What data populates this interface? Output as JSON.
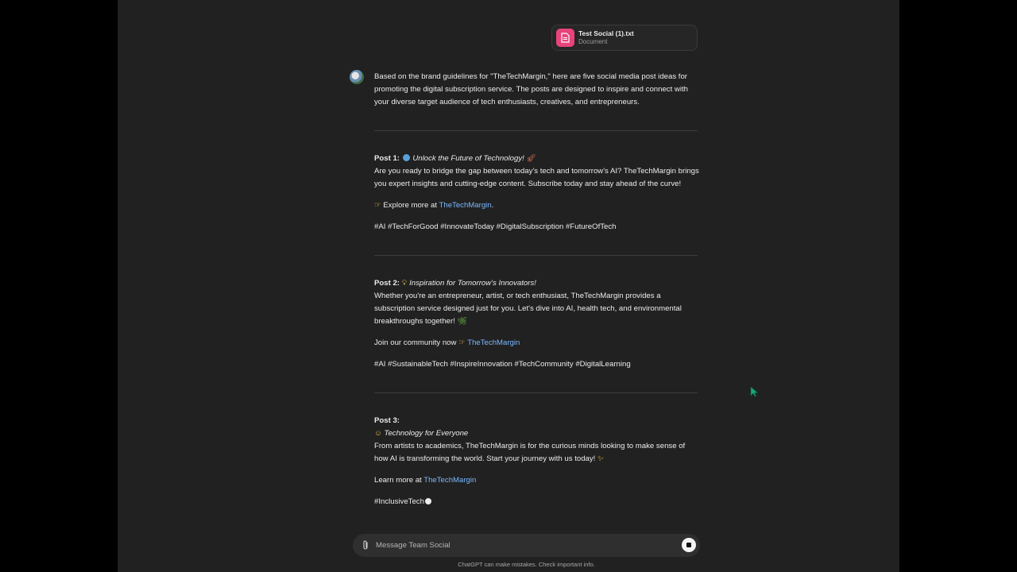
{
  "attachment": {
    "filename": "Test Social (1).txt",
    "type": "Document",
    "icon": "document-icon",
    "icon_color": "#e8437a"
  },
  "message": {
    "intro": "Based on the brand guidelines for \"TheTechMargin,\" here are five social media post ideas for promoting the digital subscription service. The posts are designed to inspire and connect with your diverse target audience of tech enthusiasts, creatives, and entrepreneurs.",
    "posts": [
      {
        "label": "Post 1:",
        "title": "Unlock the Future of Technology!",
        "body": "Are you ready to bridge the gap between today's tech and tomorrow's AI? TheTechMargin brings you expert insights and cutting-edge content. Subscribe today and stay ahead of the curve!",
        "cta_text": "Explore more at",
        "cta_link": "TheTechMargin",
        "cta_suffix": ".",
        "hashtags": "#AI #TechForGood #InnovateToday #DigitalSubscription #FutureOfTech"
      },
      {
        "label": "Post 2:",
        "title": "Inspiration for Tomorrow's Innovators!",
        "body": "Whether you're an entrepreneur, artist, or tech enthusiast, TheTechMargin provides a subscription service designed just for you. Let's dive into AI, health tech, and environmental breakthroughs together!",
        "cta_text": "Join our community now",
        "cta_link": "TheTechMargin",
        "hashtags": "#AI #SustainableTech #InspireInnovation #TechCommunity #DigitalLearning"
      },
      {
        "label": "Post 3:",
        "title": "Technology for Everyone",
        "body": "From artists to academics, TheTechMargin is for the curious minds looking to make sense of how AI is transforming the world. Start your journey with us today!",
        "cta_text": "Learn more at",
        "cta_link": "TheTechMargin",
        "hashtags": "#InclusiveTech"
      }
    ]
  },
  "composer": {
    "placeholder": "Message Team Social",
    "disclaimer": "ChatGPT can make mistakes. Check important info."
  },
  "colors": {
    "background": "#212121",
    "link": "#7ab7ff",
    "composer": "#2f2f2f",
    "cursor": "#18a87f"
  }
}
